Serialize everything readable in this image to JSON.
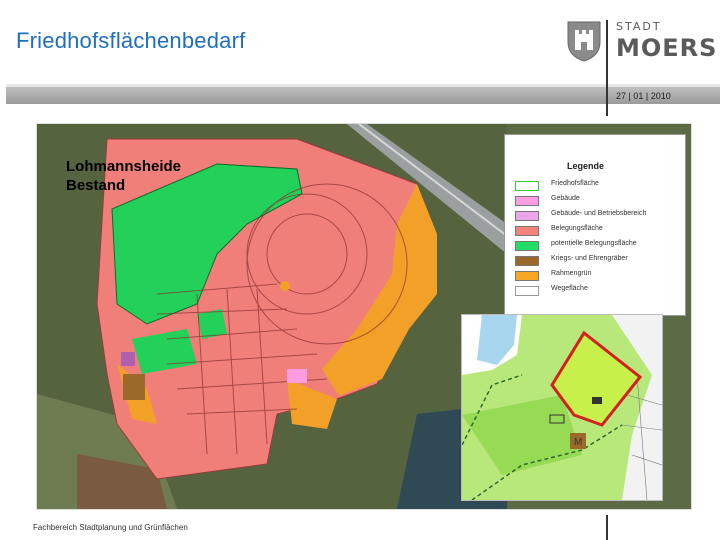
{
  "header": {
    "title": "Friedhofsflächenbedarf",
    "date": "27 | 01 | 2010",
    "logo": {
      "stadt": "STADT",
      "name": "MOERS",
      "emblem": "castle-shield-icon"
    }
  },
  "map": {
    "label_line1": "Lohmannsheide",
    "label_line2": "Bestand"
  },
  "legend": {
    "title": "Legende",
    "items": [
      {
        "label": "Friedhofsfläche",
        "color": "#ffffff",
        "border": "#33cc33"
      },
      {
        "label": "Gebäude",
        "color": "#ff9de0",
        "border": "#777777"
      },
      {
        "label": "Gebäude- und Betriebsbereich",
        "color": "#e9a6e9",
        "border": "#777777"
      },
      {
        "label": "Belegungsfläche",
        "color": "#f4837b",
        "border": "#777777"
      },
      {
        "label": "potentielle Belegungsfläche",
        "color": "#22dd66",
        "border": "#777777"
      },
      {
        "label": "Kriegs- und Ehrengräber",
        "color": "#9b6a2a",
        "border": "#777777"
      },
      {
        "label": "Rahmengrün",
        "color": "#f7a823",
        "border": "#777777"
      },
      {
        "label": "Wegefläche",
        "color": "#ffffff",
        "border": "#999999"
      }
    ]
  },
  "inset": {
    "marker_label": "M"
  },
  "footer": {
    "department": "Fachbereich Stadtplanung und Grünflächen"
  },
  "colors": {
    "title": "#1f6fc0",
    "bar": "#9a9a9a"
  }
}
